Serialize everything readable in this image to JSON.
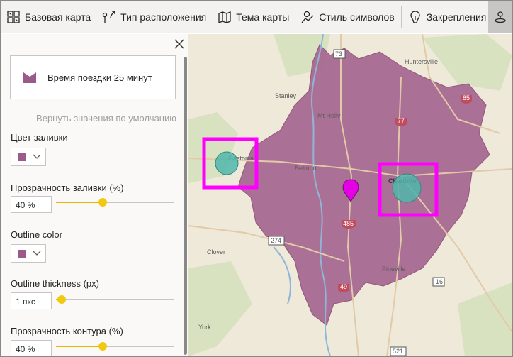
{
  "toolbar": {
    "items": [
      {
        "label": "Базовая карта",
        "icon": "basemap-icon"
      },
      {
        "label": "Тип расположения",
        "icon": "location-type-icon"
      },
      {
        "label": "Тема карты",
        "icon": "map-theme-icon"
      },
      {
        "label": "Стиль символов",
        "icon": "symbol-style-icon"
      },
      {
        "label": "Закрепления",
        "icon": "pins-icon"
      }
    ],
    "last_icon": "travel-time-icon"
  },
  "panel": {
    "preset_label": "Время поездки 25 минут",
    "reset_label": "Вернуть значения по умолчанию",
    "fill_color_label": "Цвет заливки",
    "fill_color": "#9b5a8a",
    "fill_transparency_label": "Прозрачность заливки (%)",
    "fill_transparency_value": "40 %",
    "fill_transparency_level": 0.4,
    "outline_color_label": "Outline color",
    "outline_color": "#9b5a8a",
    "outline_thickness_label": "Outline thickness (px)",
    "outline_thickness_value": "1 пкс",
    "outline_thickness_level": 0.05,
    "outline_transparency_label": "Прозрачность контура (%)",
    "outline_transparency_value": "40 %",
    "outline_transparency_level": 0.4
  },
  "map": {
    "places": [
      "Huntersville",
      "Stanley",
      "Mt Holly",
      "Belmont",
      "Charlotte",
      "Gastonia",
      "Clover",
      "Pineville",
      "York"
    ],
    "highways": [
      "73",
      "77",
      "85",
      "485",
      "274",
      "16",
      "521",
      "49"
    ],
    "colors": {
      "isochrone": "#a86a92",
      "highlight": "#ff00ff",
      "marker": "#4fb6aa",
      "pin": "#e600e6"
    }
  }
}
